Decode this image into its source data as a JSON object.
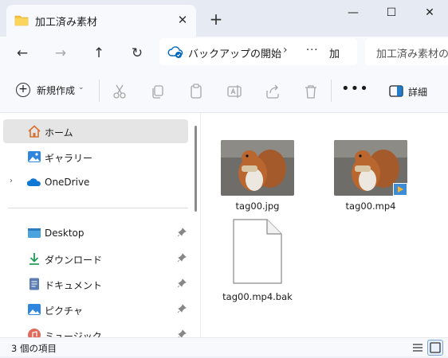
{
  "tab": {
    "title": "加工済み素材",
    "close": "✕",
    "new_tab": "+"
  },
  "window_controls": {
    "minimize": "—",
    "maximize": "☐",
    "close": "✕"
  },
  "navigation": {
    "back": "←",
    "forward": "→",
    "up": "↑",
    "refresh": "↻"
  },
  "address": {
    "crumb_root": "バックアップの開始",
    "separator": "›",
    "ellipsis": "···",
    "crumb_current": "加"
  },
  "search": {
    "placeholder": "加工済み素材の"
  },
  "toolbar": {
    "new_label": "新規作成",
    "new_chevron": "⌄",
    "more": "•••",
    "details_label": "詳細"
  },
  "sidebar": {
    "items": [
      {
        "label": "ホーム",
        "icon": "home-icon",
        "selected": true
      },
      {
        "label": "ギャラリー",
        "icon": "gallery-icon"
      },
      {
        "label": "OneDrive",
        "icon": "onedrive-icon",
        "expandable": true
      },
      {
        "label": "Desktop",
        "icon": "desktop-icon",
        "pinned": true
      },
      {
        "label": "ダウンロード",
        "icon": "download-icon",
        "pinned": true
      },
      {
        "label": "ドキュメント",
        "icon": "documents-icon",
        "pinned": true
      },
      {
        "label": "ピクチャ",
        "icon": "pictures-icon",
        "pinned": true
      },
      {
        "label": "ミュージック",
        "icon": "music-icon",
        "pinned": true
      }
    ]
  },
  "files": [
    {
      "name": "tag00.jpg",
      "type": "image"
    },
    {
      "name": "tag00.mp4",
      "type": "video"
    },
    {
      "name": "tag00.mp4.bak",
      "type": "generic"
    }
  ],
  "status": {
    "item_count": "3 個の項目"
  },
  "colors": {
    "accent": "#0067c0",
    "folder": "#f6c343",
    "selection": "#e5e5e5"
  }
}
